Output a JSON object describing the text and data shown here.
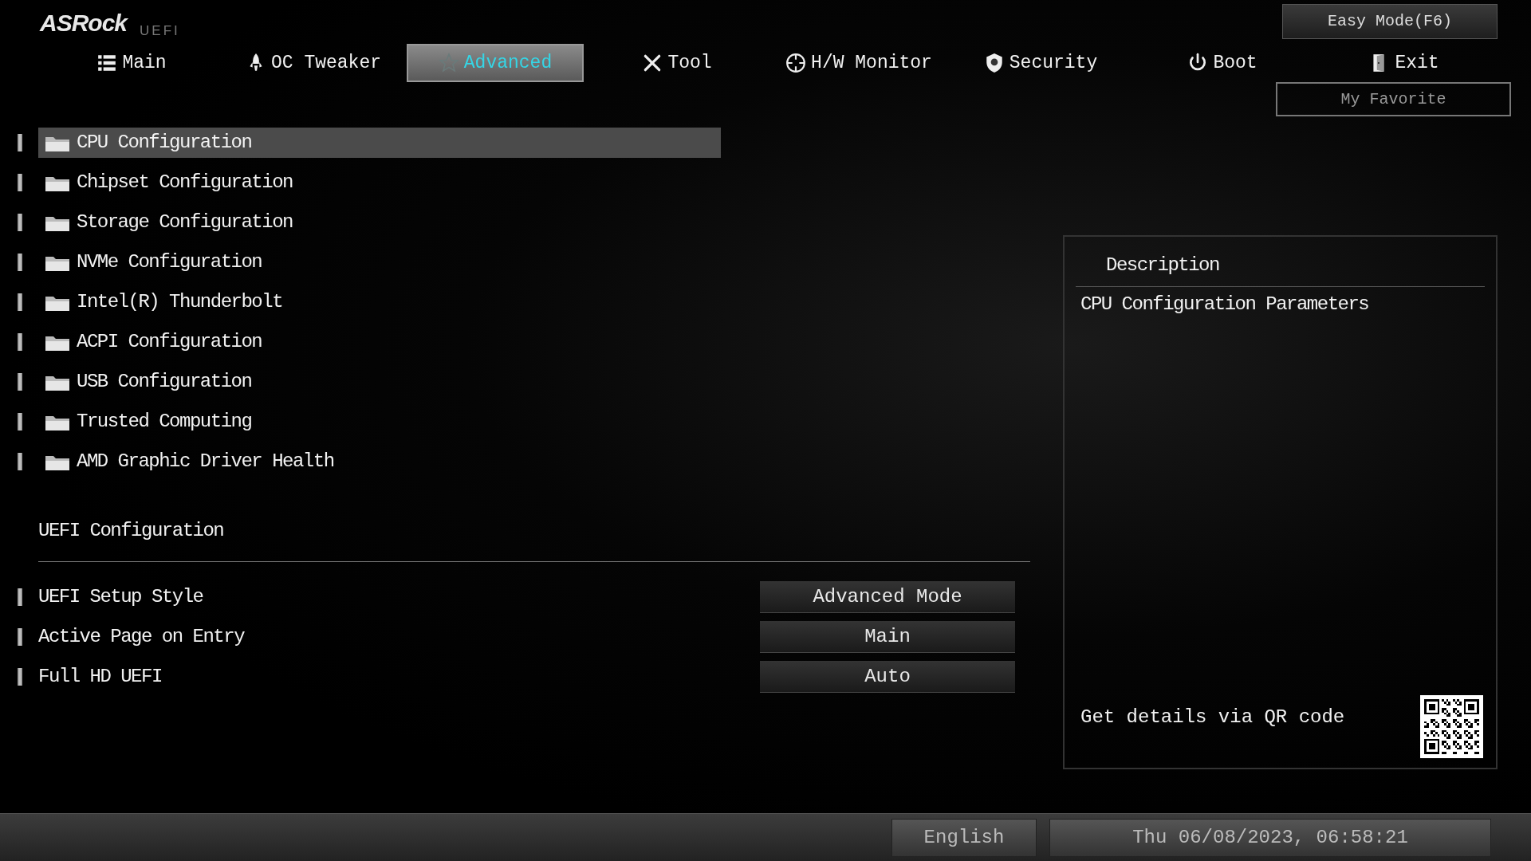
{
  "logo": {
    "brand": "ASRock",
    "suffix": "UEFI"
  },
  "easy_mode_button": "Easy Mode(F6)",
  "my_favorite_button": "My Favorite",
  "tabs": [
    {
      "label": "Main",
      "selected": false
    },
    {
      "label": "OC Tweaker",
      "selected": false
    },
    {
      "label": "Advanced",
      "selected": true
    },
    {
      "label": "Tool",
      "selected": false
    },
    {
      "label": "H/W Monitor",
      "selected": false
    },
    {
      "label": "Security",
      "selected": false
    },
    {
      "label": "Boot",
      "selected": false
    },
    {
      "label": "Exit",
      "selected": false
    }
  ],
  "menu_items": [
    {
      "label": "CPU Configuration",
      "selected": true
    },
    {
      "label": "Chipset Configuration",
      "selected": false
    },
    {
      "label": "Storage Configuration",
      "selected": false
    },
    {
      "label": "NVMe Configuration",
      "selected": false
    },
    {
      "label": "Intel(R) Thunderbolt",
      "selected": false
    },
    {
      "label": "ACPI Configuration",
      "selected": false
    },
    {
      "label": "USB Configuration",
      "selected": false
    },
    {
      "label": "Trusted Computing",
      "selected": false
    },
    {
      "label": "AMD Graphic Driver Health",
      "selected": false
    }
  ],
  "section_title": "UEFI Configuration",
  "settings": [
    {
      "label": "UEFI Setup Style",
      "value": "Advanced Mode"
    },
    {
      "label": "Active Page on Entry",
      "value": "Main"
    },
    {
      "label": "Full HD UEFI",
      "value": "Auto"
    }
  ],
  "description": {
    "title": "Description",
    "text": "CPU Configuration Parameters",
    "qr_hint": "Get details via QR code"
  },
  "status_bar": {
    "language": "English",
    "datetime": "Thu 06/08/2023, 06:58:21"
  }
}
